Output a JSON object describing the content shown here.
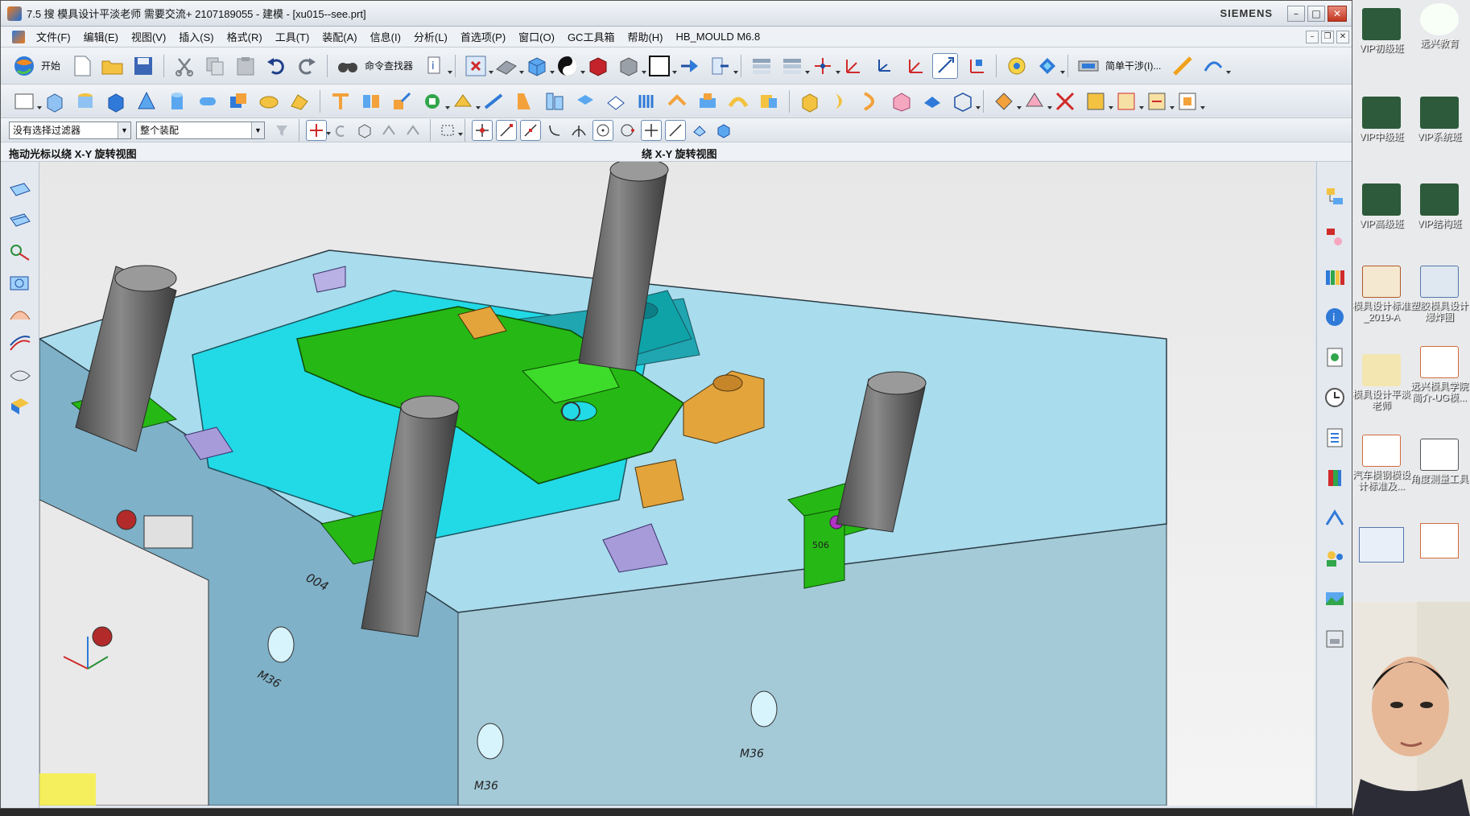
{
  "window": {
    "title": "7.5 搜 模具设计平淡老师  需要交流+ 2107189055 - 建模 - [xu015--see.prt]",
    "brand": "SIEMENS",
    "buttons": {
      "minimize": "–",
      "maximize": "□",
      "close": "✕"
    }
  },
  "menubar": {
    "items": [
      "文件(F)",
      "编辑(E)",
      "视图(V)",
      "插入(S)",
      "格式(R)",
      "工具(T)",
      "装配(A)",
      "信息(I)",
      "分析(L)",
      "首选项(P)",
      "窗口(O)",
      "GC工具箱",
      "帮助(H)",
      "HB_MOULD M6.8"
    ]
  },
  "toolbar1": {
    "start_label": "开始",
    "command_finder_label": "命令查找器",
    "simple_interference_label": "简单干涉(I)..."
  },
  "selection_bar": {
    "filter_value": "没有选择过滤器",
    "scope_value": "整个装配"
  },
  "status": {
    "prompt": "拖动光标以绕 X-Y 旋转视图",
    "center_prompt": "绕 X-Y 旋转视图"
  },
  "model_labels": [
    "M36",
    "M36",
    "M36",
    "004",
    "506"
  ],
  "desktop": {
    "icons": [
      "VIP初级班",
      "远兴教育",
      "VIP中级班",
      "VIP系统班",
      "VIP高级班",
      "VIP结构班",
      "模具设计标准_2019-A",
      "塑胶模具设计爆炸图",
      "模具设计平淡老师",
      "远兴模具学院简介-UG模...",
      "汽车模钢模设计标准及...",
      "角度测量工具"
    ]
  },
  "colors": {
    "mold_base": "#84b9cf",
    "plate_top": "#a9dcec",
    "cavity_cyan": "#22d9e6",
    "part_green": "#26b814",
    "slider_orange": "#e3a43b",
    "guide_pin": "#6e6e6e",
    "lifter_purple": "#a79bd9"
  }
}
